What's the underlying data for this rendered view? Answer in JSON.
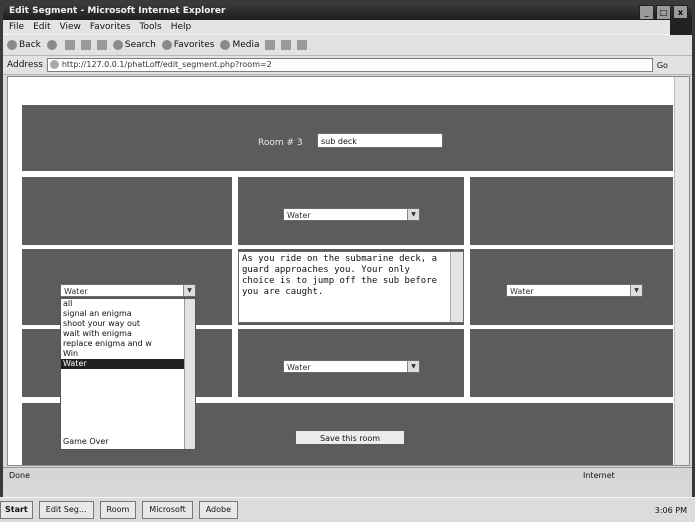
{
  "window": {
    "title": "Edit Segment - Microsoft Internet Explorer",
    "sys_buttons": [
      "_",
      "□",
      "x"
    ]
  },
  "menubar": {
    "items": [
      "File",
      "Edit",
      "View",
      "Favorites",
      "Tools",
      "Help"
    ]
  },
  "toolbar": {
    "back": "Back",
    "search": "Search",
    "favorites": "Favorites",
    "media": "Media"
  },
  "addressbar": {
    "label": "Address",
    "url": "http://127.0.0.1/phatLoff/edit_segment.php?room=2",
    "go": "Go"
  },
  "page": {
    "room_label": "Room # 3",
    "room_value": "sub deck",
    "select_value": "Water",
    "description": "As you ride on the submarine deck, a guard approaches you.  Your only choice is to jump off the sub before you are caught.",
    "save_label": "Save this room",
    "dropdown_options": [
      "all",
      "signal an enigma",
      "shoot your way out",
      "wait with enigma",
      "replace enigma and w",
      "Win",
      "Water",
      "",
      "",
      "",
      "Game Over"
    ],
    "dropdown_selected_index": 6
  },
  "status": {
    "left": "Done",
    "right": "Internet"
  },
  "taskbar": {
    "start": "Start",
    "tasks": [
      "Edit Seg...",
      "Room",
      "Microsoft",
      "Adobe"
    ],
    "clock": "3:06 PM"
  }
}
